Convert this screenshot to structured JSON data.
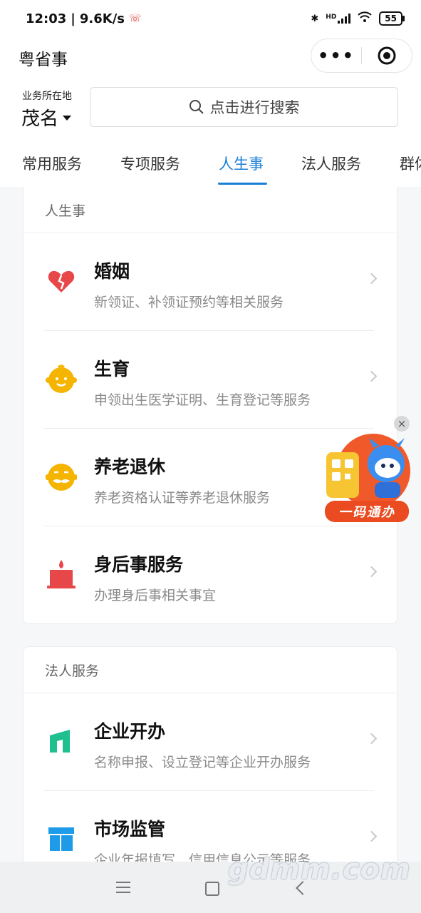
{
  "status": {
    "time": "12:03",
    "speed": "9.6K/s",
    "network": "HD",
    "battery": "55"
  },
  "app": {
    "title": "粤省事"
  },
  "location": {
    "label": "业务所在地",
    "city": "茂名"
  },
  "search": {
    "placeholder": "点击进行搜索"
  },
  "tabs": [
    {
      "label": "常用服务"
    },
    {
      "label": "专项服务"
    },
    {
      "label": "人生事",
      "active": true
    },
    {
      "label": "法人服务"
    },
    {
      "label": "群体"
    }
  ],
  "sections": [
    {
      "title": "人生事",
      "items": [
        {
          "title": "婚姻",
          "subtitle": "新领证、补领证预约等相关服务",
          "icon": "heart-icon"
        },
        {
          "title": "生育",
          "subtitle": "申领出生医学证明、生育登记等服务",
          "icon": "baby-face-icon"
        },
        {
          "title": "养老退休",
          "subtitle": "养老资格认证等养老退休服务",
          "icon": "elder-face-icon"
        },
        {
          "title": "身后事服务",
          "subtitle": "办理身后事相关事宜",
          "icon": "candle-icon"
        }
      ]
    },
    {
      "title": "法人服务",
      "items": [
        {
          "title": "企业开办",
          "subtitle": "名称申报、设立登记等企业开办服务",
          "icon": "building-icon"
        },
        {
          "title": "市场监管",
          "subtitle": "企业年报填写、信用信息公示等服务",
          "icon": "store-icon"
        }
      ]
    }
  ],
  "float_badge": {
    "label": "一码通办"
  },
  "watermark": "gdmm.com",
  "colors": {
    "accent": "#1b7fd6",
    "red": "#e8474a",
    "yellow": "#f5b400",
    "green": "#1fbf8f",
    "blue": "#1d9be8"
  }
}
